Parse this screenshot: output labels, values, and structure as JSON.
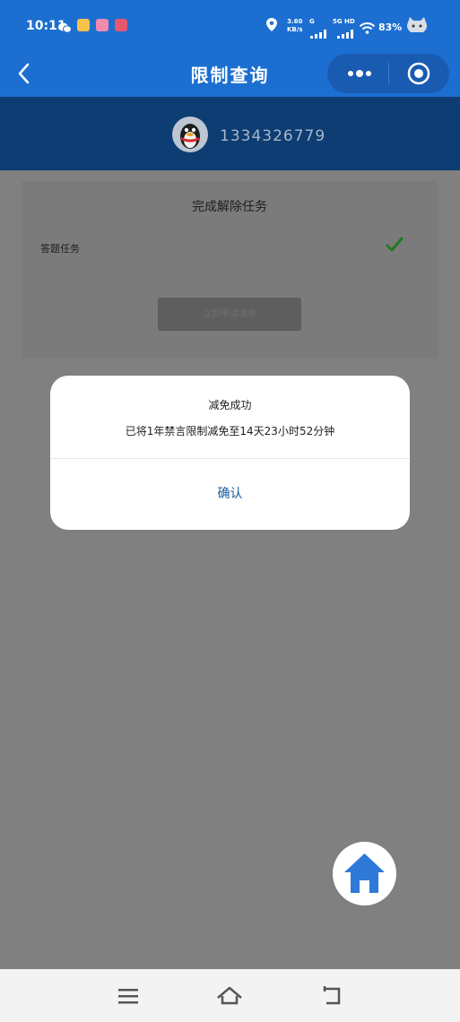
{
  "status_bar": {
    "time": "10:11",
    "net_speed_value": "3.60",
    "net_speed_unit": "KB/s",
    "sim1_label": "G",
    "sim2_label": "5G HD",
    "battery": "83%"
  },
  "header": {
    "title": "限制查询",
    "back_icon": "chevron-left-icon",
    "more_icon": "more-dots-icon",
    "close_icon": "target-circle-icon"
  },
  "user": {
    "uid": "1334326779",
    "avatar_icon": "qq-penguin-icon"
  },
  "task_card": {
    "title": "完成解除任务",
    "task_name": "答题任务",
    "task_status_icon": "checkmark-icon",
    "button_label": "立即申请减免"
  },
  "dialog": {
    "title": "减免成功",
    "message": "已将1年禁言限制减免至14天23小时52分钟",
    "confirm_label": "确认"
  },
  "fab": {
    "icon": "home-icon"
  },
  "nav_bar": {
    "menu_icon": "menu-icon",
    "home_icon": "home-outline-icon",
    "back_icon": "back-arrow-icon"
  },
  "colors": {
    "primary": "#1c6fd1",
    "banner": "#0d3d73",
    "overlay": "#808080",
    "check": "#1f7a1f",
    "confirm_text": "#1a5a9a",
    "fab_icon": "#2f7ad8"
  }
}
